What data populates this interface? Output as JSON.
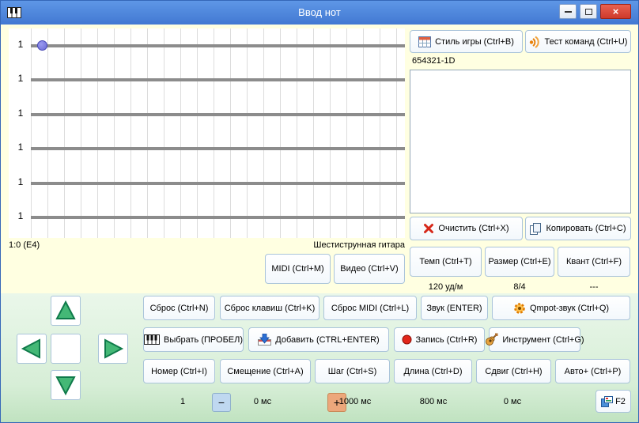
{
  "window": {
    "title": "Ввод нот",
    "controls": {
      "close_glyph": "×"
    }
  },
  "colors": {
    "titlebar": "#4278D2",
    "background_top": "#FFFFE1",
    "background_bottom": "#D7EED7",
    "close_button": "#CE3A2C",
    "string": "#8C8C8C",
    "note_dot": "#6A6AD6",
    "arrow_green": "#44B876",
    "minus_button": "#BFD8F0",
    "plus_button": "#ECA77B"
  },
  "icons": [
    "piano-icon",
    "style-table-icon",
    "ear-icon",
    "clear-x-icon",
    "copy-icon",
    "gear-icon",
    "piano-keys-icon",
    "insert-arrow-icon",
    "record-dot-icon",
    "guitar-icon",
    "window-f2-icon",
    "minimize-icon",
    "maximize-icon",
    "close-icon",
    "arrow-up-icon",
    "arrow-down-icon",
    "arrow-left-icon",
    "arrow-right-icon"
  ],
  "fretboard": {
    "strings": [
      "1",
      "1",
      "1",
      "1",
      "1",
      "1"
    ],
    "position": "1:0 (E4)",
    "instrument": "Шестиструнная гитара",
    "midi_button": "MIDI (Ctrl+M)",
    "video_button": "Видео (Ctrl+V)"
  },
  "right_panel": {
    "style_button": "Стиль игры (Ctrl+B)",
    "test_button": "Тест команд (Ctrl+U)",
    "tuning_label": "654321-1D",
    "clear_button": "Очистить (Ctrl+X)",
    "copy_button": "Копировать (Ctrl+C)",
    "tempo_button": "Темп (Ctrl+T)",
    "meter_button": "Размер (Ctrl+E)",
    "quant_button": "Квант (Ctrl+F)",
    "tempo_value": "120 уд/м",
    "meter_value": "8/4",
    "quant_value": "---"
  },
  "control_panel": {
    "reset_button": "Сброс (Ctrl+N)",
    "reset_keys_button": "Сброс клавиш (Ctrl+K)",
    "reset_midi_button": "Сброс MIDI (Ctrl+L)",
    "sound_button": "Звук (ENTER)",
    "qmpot_button": "Qmpot-звук (Ctrl+Q)",
    "select_button": "Выбрать (ПРОБЕЛ)",
    "add_button": "Добавить (CTRL+ENTER)",
    "record_button": "Запись (Ctrl+R)",
    "instrument_button": "Инструмент (Ctrl+G)",
    "number_button": "Номер (Ctrl+I)",
    "offset_button": "Смещение (Ctrl+A)",
    "step_button": "Шаг (Ctrl+S)",
    "length_button": "Длина (Ctrl+D)",
    "shift_button": "Сдвиг (Ctrl+H)",
    "auto_button": "Авто+ (Ctrl+P)"
  },
  "status_bar": {
    "number_value": "1",
    "minus": "−",
    "offset_value": "0 мс",
    "plus": "+",
    "step_value": "1000 мс",
    "length_value": "800 мс",
    "shift_value": "0 мс",
    "f2_label": "F2"
  }
}
